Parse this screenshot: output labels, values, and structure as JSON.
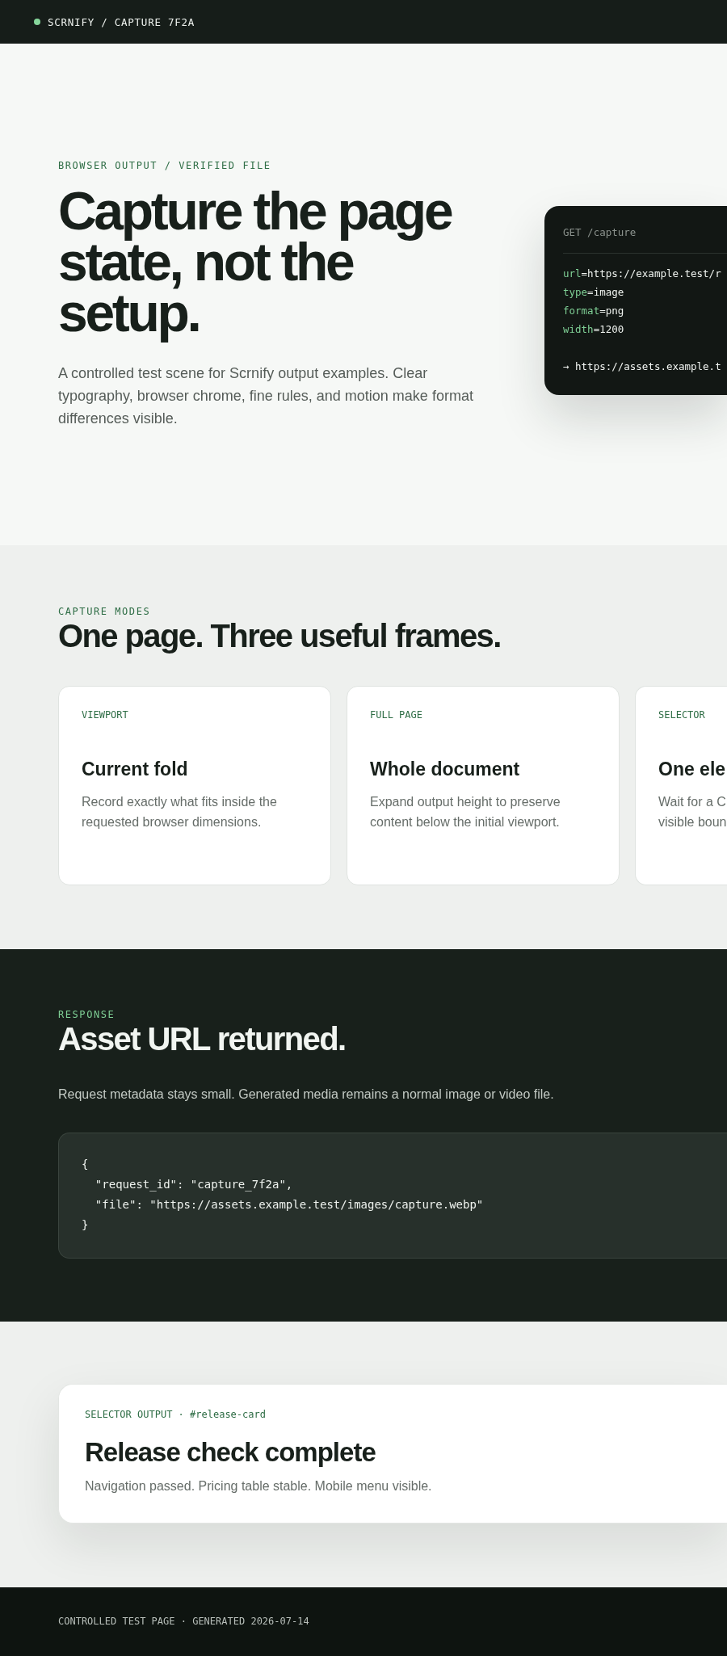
{
  "top_bar": {
    "title": "SCRNIFY / CAPTURE 7F2A"
  },
  "hero": {
    "eyebrow": "BROWSER OUTPUT / VERIFIED FILE",
    "title": "Capture the page\nstate, not the\nsetup.",
    "description": "A controlled test scene for Scrnify output examples. Clear typography, browser chrome, fine rules, and motion make format differences visible.",
    "request_card": {
      "request": "GET /capture",
      "params": [
        {
          "key": "url",
          "value": "=https://example.test/r"
        },
        {
          "key": "type",
          "value": "=image"
        },
        {
          "key": "format",
          "value": "=png"
        },
        {
          "key": "width",
          "value": "=1200"
        }
      ],
      "result": "→ https://assets.example.t"
    }
  },
  "capture_modes": {
    "eyebrow": "CAPTURE MODES",
    "title": "One page. Three useful frames.",
    "cards": [
      {
        "label": "VIEWPORT",
        "title": "Current fold",
        "description": "Record exactly what fits inside the requested browser dimensions."
      },
      {
        "label": "FULL PAGE",
        "title": "Whole document",
        "description": "Expand output height to preserve content below the initial viewport."
      },
      {
        "label": "SELECTOR",
        "title": "One ele",
        "description": "Wait for a C visible boun"
      }
    ]
  },
  "response": {
    "eyebrow": "RESPONSE",
    "title": "Asset URL returned.",
    "description": "Request metadata stays small. Generated media remains a normal image or video file.",
    "code_lines": [
      "{",
      "  \"request_id\": \"capture_7f2a\",",
      "  \"file\": \"https://assets.example.test/images/capture.webp\"",
      "}"
    ]
  },
  "selector_output": {
    "label": "SELECTOR OUTPUT · #release-card",
    "title": "Release check complete",
    "description": "Navigation passed. Pricing table stable. Mobile menu visible."
  },
  "footer": {
    "text": "CONTROLLED TEST PAGE · GENERATED 2026-07-14"
  }
}
